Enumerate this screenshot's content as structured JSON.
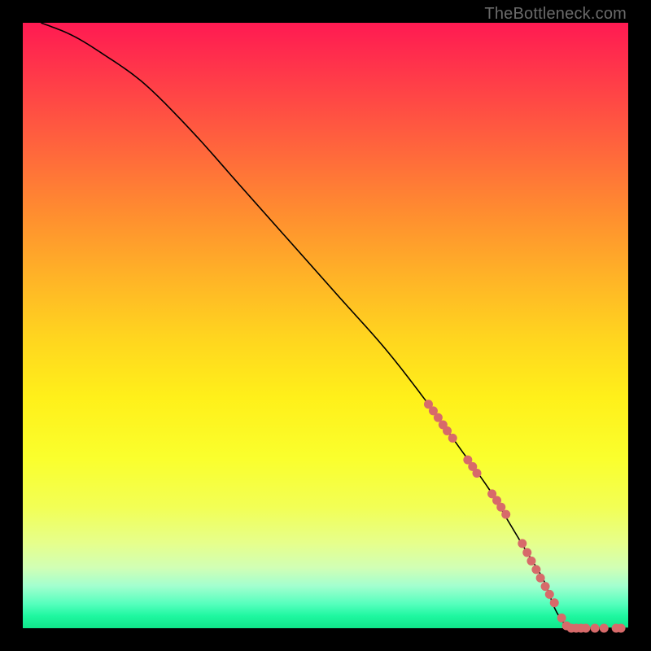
{
  "watermark": "TheBottleneck.com",
  "chart_data": {
    "type": "line",
    "title": "",
    "xlabel": "",
    "ylabel": "",
    "xlim": [
      0,
      100
    ],
    "ylim": [
      0,
      100
    ],
    "series": [
      {
        "name": "curve",
        "x": [
          3,
          8,
          13,
          20,
          28,
          36,
          44,
          52,
          60,
          67,
          72,
          77,
          80,
          83,
          86,
          88,
          90
        ],
        "y": [
          100,
          98,
          95,
          90,
          82,
          73,
          64,
          55,
          46,
          37,
          30,
          23,
          18,
          13,
          8,
          3,
          0
        ]
      },
      {
        "name": "flat-tail",
        "x": [
          90,
          100
        ],
        "y": [
          0,
          0
        ]
      }
    ],
    "markers": [
      {
        "x": 67.0,
        "y": 37.0
      },
      {
        "x": 67.8,
        "y": 35.9
      },
      {
        "x": 68.6,
        "y": 34.8
      },
      {
        "x": 69.4,
        "y": 33.6
      },
      {
        "x": 70.1,
        "y": 32.6
      },
      {
        "x": 71.0,
        "y": 31.4
      },
      {
        "x": 73.5,
        "y": 27.8
      },
      {
        "x": 74.3,
        "y": 26.7
      },
      {
        "x": 75.0,
        "y": 25.6
      },
      {
        "x": 77.5,
        "y": 22.2
      },
      {
        "x": 78.3,
        "y": 21.1
      },
      {
        "x": 79.0,
        "y": 20.0
      },
      {
        "x": 79.8,
        "y": 18.8
      },
      {
        "x": 82.5,
        "y": 14.0
      },
      {
        "x": 83.3,
        "y": 12.5
      },
      {
        "x": 84.0,
        "y": 11.1
      },
      {
        "x": 84.8,
        "y": 9.7
      },
      {
        "x": 85.5,
        "y": 8.3
      },
      {
        "x": 86.3,
        "y": 6.9
      },
      {
        "x": 87.0,
        "y": 5.6
      },
      {
        "x": 87.8,
        "y": 4.2
      },
      {
        "x": 89.0,
        "y": 1.7
      },
      {
        "x": 89.8,
        "y": 0.4
      },
      {
        "x": 90.6,
        "y": 0.0
      },
      {
        "x": 91.4,
        "y": 0.0
      },
      {
        "x": 92.2,
        "y": 0.0
      },
      {
        "x": 93.0,
        "y": 0.0
      },
      {
        "x": 94.5,
        "y": 0.0
      },
      {
        "x": 96.0,
        "y": 0.0
      },
      {
        "x": 98.0,
        "y": 0.0
      },
      {
        "x": 98.8,
        "y": 0.0
      }
    ],
    "marker_radius_px": 5.5,
    "marker_color": "#d76a6a"
  }
}
